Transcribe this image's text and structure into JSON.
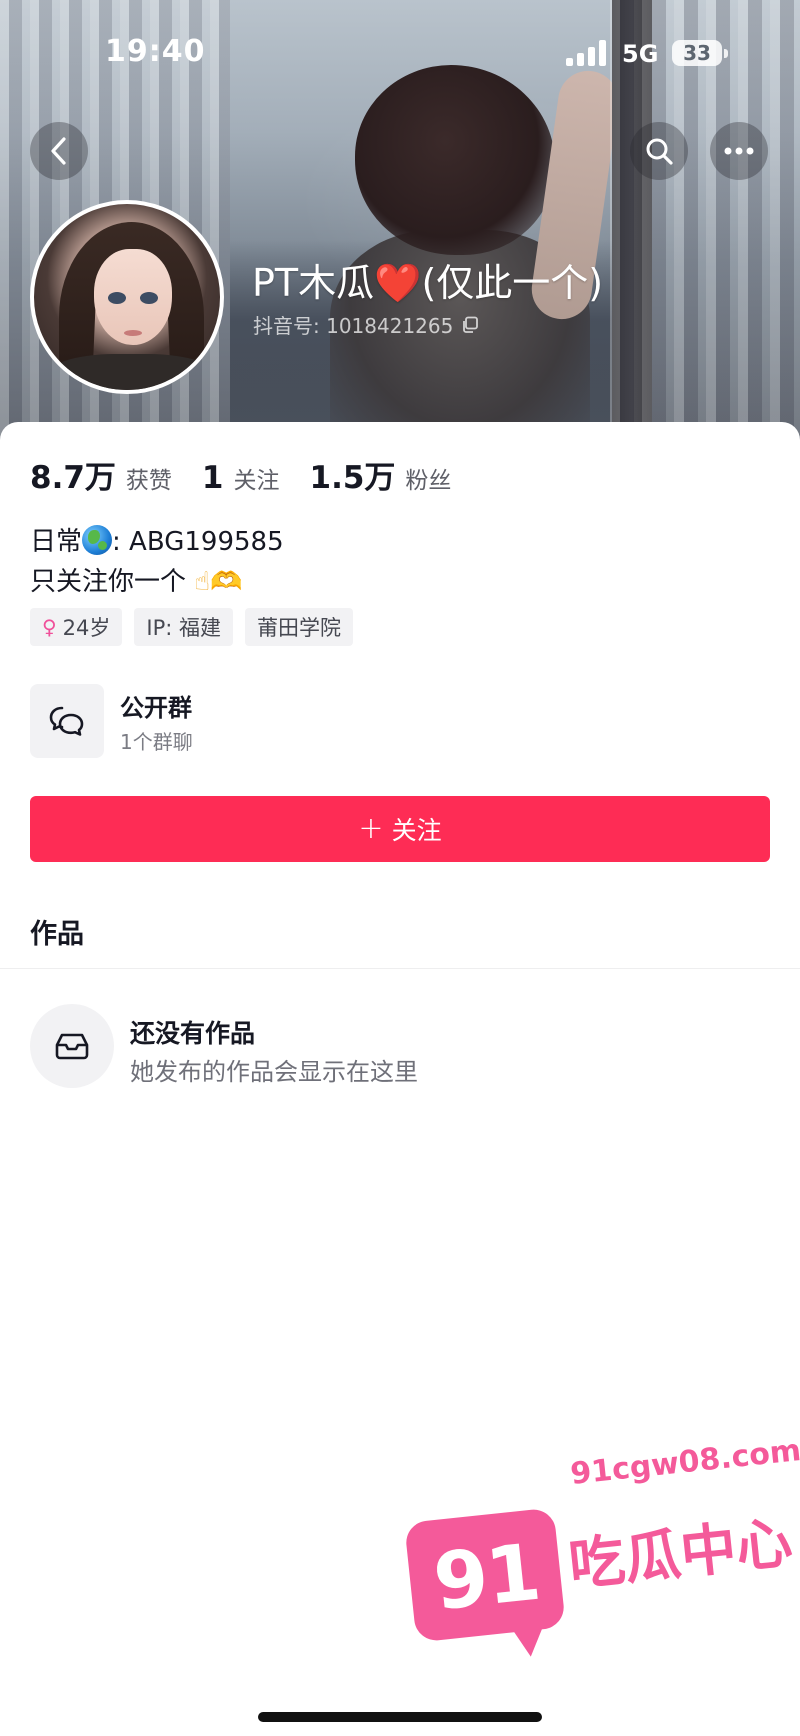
{
  "status_bar": {
    "time": "19:40",
    "network": "5G",
    "battery": "33"
  },
  "header": {
    "display_name": "PT木瓜",
    "display_name_suffix": "(仅此一个)",
    "heart_emoji": "❤️",
    "account_id_label": "抖音号: 1018421265",
    "icons": [
      "back-icon",
      "search-icon",
      "more-icon",
      "copy-icon"
    ]
  },
  "stats": [
    {
      "value": "8.7万",
      "label": "获赞"
    },
    {
      "value": "1",
      "label": "关注"
    },
    {
      "value": "1.5万",
      "label": "粉丝"
    }
  ],
  "bio": {
    "line1_prefix": "日常",
    "line1_suffix": ": ABG199585",
    "line2_text": "只关注你一个",
    "line2_emojis": "☝🫶"
  },
  "tags": [
    {
      "icon": "female-icon",
      "text": "24岁"
    },
    {
      "text": "IP: 福建"
    },
    {
      "text": "莆田学院"
    }
  ],
  "group": {
    "title": "公开群",
    "subtitle": "1个群聊",
    "icon": "chat-bubbles-icon"
  },
  "follow_button": {
    "plus": "+",
    "label": "关注",
    "color": "#fe2c55"
  },
  "works": {
    "tab_label": "作品",
    "empty_title": "还没有作品",
    "empty_subtitle": "她发布的作品会显示在这里",
    "empty_icon": "inbox-tray-icon"
  },
  "watermark": {
    "number": "91",
    "url": "91cgw08.com",
    "text": "吃瓜中心",
    "color": "#f45a9a"
  }
}
